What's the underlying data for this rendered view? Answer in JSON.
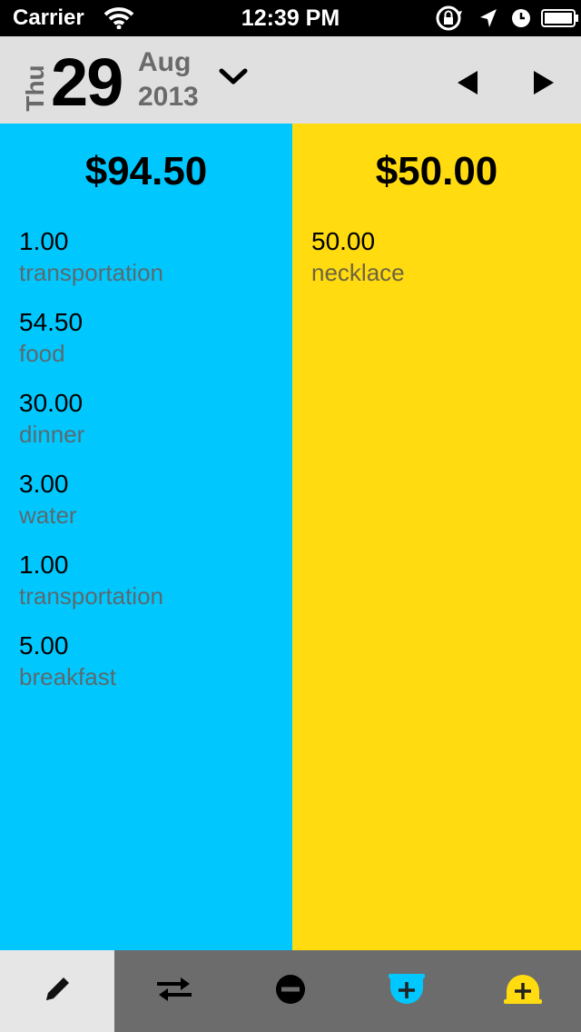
{
  "status_bar": {
    "carrier": "Carrier",
    "time": "12:39 PM",
    "icons": [
      "wifi-icon",
      "rotation-lock-icon",
      "location-arrow-icon",
      "alarm-icon",
      "battery-icon"
    ]
  },
  "date_header": {
    "weekday": "Thu",
    "day": "29",
    "month": "Aug",
    "year": "2013",
    "icons": [
      "chevron-down-icon",
      "previous-day-icon",
      "next-day-icon"
    ]
  },
  "columns": {
    "left": {
      "color": "#00c8ff",
      "total": "$94.50",
      "entries": [
        {
          "amount": "1.00",
          "category": "transportation"
        },
        {
          "amount": "54.50",
          "category": "food"
        },
        {
          "amount": "30.00",
          "category": "dinner"
        },
        {
          "amount": "3.00",
          "category": "water"
        },
        {
          "amount": "1.00",
          "category": "transportation"
        },
        {
          "amount": "5.00",
          "category": "breakfast"
        }
      ]
    },
    "right": {
      "color": "#ffdb10",
      "total": "$50.00",
      "entries": [
        {
          "amount": "50.00",
          "category": "necklace"
        }
      ]
    }
  },
  "tab_bar": {
    "selected": "edit",
    "tabs": [
      {
        "id": "edit",
        "icon": "pencil-icon"
      },
      {
        "id": "transfer",
        "icon": "transfer-arrows-icon"
      },
      {
        "id": "expense",
        "icon": "minus-circle-icon"
      },
      {
        "id": "add-blue",
        "icon": "add-blue-icon",
        "color": "#00c8ff"
      },
      {
        "id": "add-yellow",
        "icon": "add-yellow-icon",
        "color": "#ffdb10"
      }
    ]
  }
}
